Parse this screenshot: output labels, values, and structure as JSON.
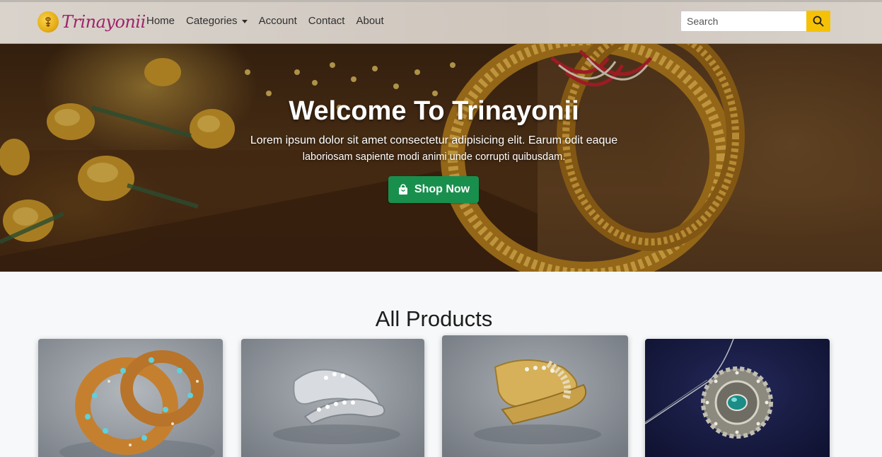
{
  "brand": {
    "name": "Trinayonii",
    "logo_icon": "trinetra-logo-icon"
  },
  "nav": {
    "items": [
      {
        "label": "Home"
      },
      {
        "label": "Categories",
        "dropdown": true
      },
      {
        "label": "Account"
      },
      {
        "label": "Contact"
      },
      {
        "label": "About"
      }
    ]
  },
  "search": {
    "placeholder": "Search",
    "button_icon": "search-icon",
    "button_color": "#f5c107"
  },
  "hero": {
    "title": "Welcome To Trinayonii",
    "subtitle_line1": "Lorem ipsum dolor sit amet consectetur adipisicing elit. Earum odit eaque",
    "subtitle_line2": "laboriosam sapiente modi animi unde corrupti quibusdam.",
    "cta_label": "Shop Now",
    "cta_icon": "shopping-bag-icon",
    "cta_color": "#198f4e"
  },
  "products": {
    "title": "All Products",
    "items": [
      {
        "image": "gold-turquoise-bangle",
        "background": "#9aa0a6"
      },
      {
        "image": "silver-crystal-ring",
        "background": "#8e949a"
      },
      {
        "image": "gold-crystal-ring",
        "background": "#8c9299"
      },
      {
        "image": "emerald-pendant-necklace",
        "background": "#1a1f45"
      }
    ]
  }
}
